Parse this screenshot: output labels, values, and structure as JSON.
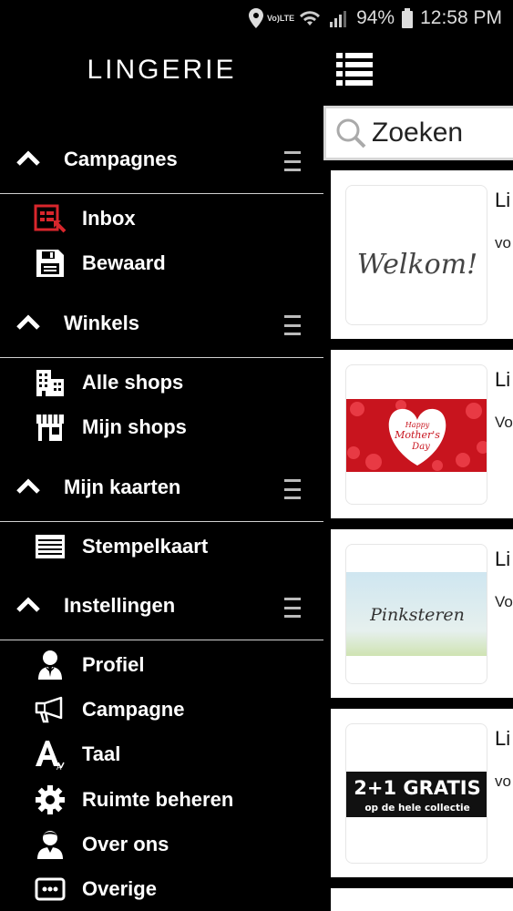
{
  "status_bar": {
    "volte_top": "Vo)",
    "volte_bottom": "LTE",
    "battery": "94%",
    "time": "12:58 PM"
  },
  "drawer": {
    "logo": "LINGERIE",
    "sections": [
      {
        "title": "Campagnes",
        "items": [
          {
            "label": "Inbox",
            "icon": "inbox-icon"
          },
          {
            "label": "Bewaard",
            "icon": "save-icon"
          }
        ]
      },
      {
        "title": "Winkels",
        "items": [
          {
            "label": "Alle shops",
            "icon": "buildings-icon"
          },
          {
            "label": "Mijn shops",
            "icon": "storefront-icon"
          }
        ]
      },
      {
        "title": "Mijn kaarten",
        "items": [
          {
            "label": "Stempelkaart",
            "icon": "card-icon"
          }
        ]
      },
      {
        "title": "Instellingen",
        "items": [
          {
            "label": "Profiel",
            "icon": "profile-icon"
          },
          {
            "label": "Campagne",
            "icon": "megaphone-icon"
          },
          {
            "label": "Taal",
            "icon": "language-icon"
          },
          {
            "label": "Ruimte beheren",
            "icon": "gear-icon"
          },
          {
            "label": "Over ons",
            "icon": "person-icon"
          },
          {
            "label": "Overige",
            "icon": "more-icon"
          }
        ]
      }
    ]
  },
  "main": {
    "search_placeholder": "Zoeken",
    "cards": [
      {
        "title": "Li",
        "subtitle": "vo",
        "image_text": "Welkom!"
      },
      {
        "title": "Li",
        "subtitle": "Vo",
        "image_text_1": "Happy",
        "image_text_2": "Mother's",
        "image_text_3": "Day"
      },
      {
        "title": "Li",
        "subtitle": "Vo",
        "image_text": "Pinksteren"
      },
      {
        "title": "Li",
        "subtitle": "vo",
        "image_text_1": "2+1 GRATIS",
        "image_text_2": "op de hele collectie"
      }
    ]
  },
  "colors": {
    "accent_red": "#d9262c",
    "background": "#000000"
  }
}
